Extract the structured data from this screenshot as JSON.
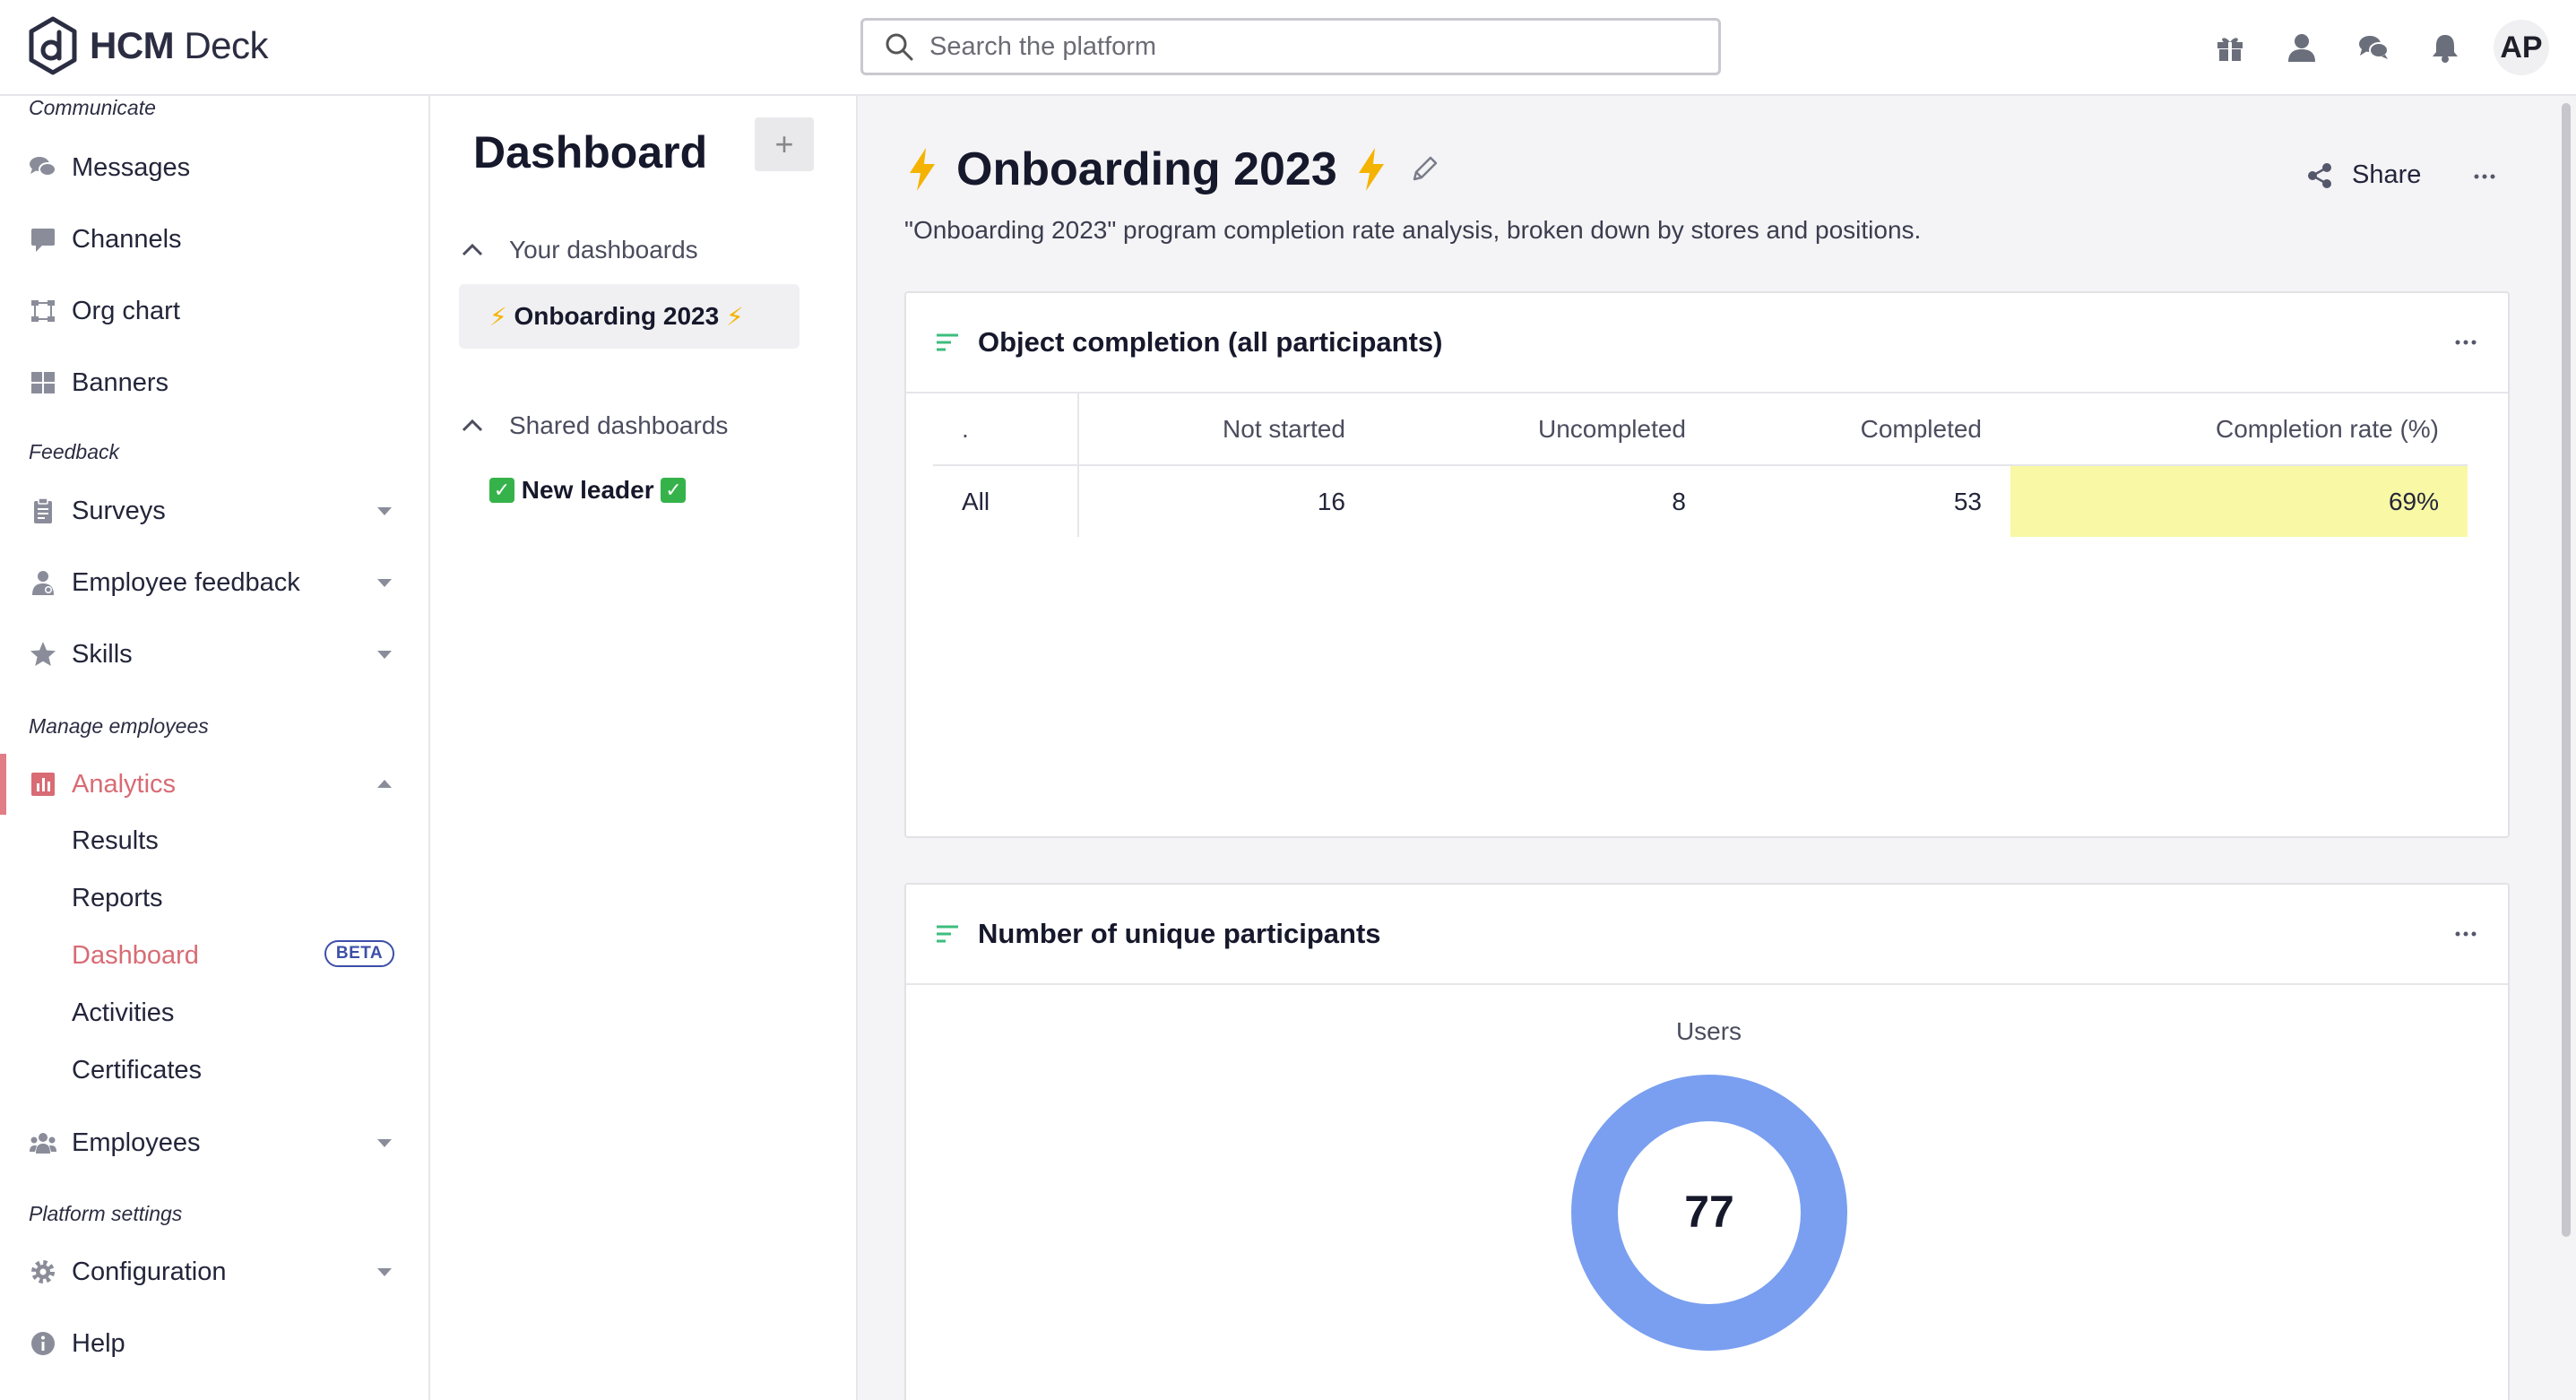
{
  "app": {
    "logo_bold": "HCM",
    "logo_light": "Deck"
  },
  "search": {
    "placeholder": "Search the platform"
  },
  "user": {
    "initials": "AP"
  },
  "top_icons": [
    "gift-icon",
    "person-icon",
    "chat-icon",
    "bell-icon"
  ],
  "sidebar": {
    "sections": {
      "communicate": "Communicate",
      "feedback": "Feedback",
      "manage": "Manage employees",
      "platform": "Platform settings"
    },
    "items": {
      "messages": "Messages",
      "channels": "Channels",
      "org_chart": "Org chart",
      "banners": "Banners",
      "surveys": "Surveys",
      "employee_feedback": "Employee feedback",
      "skills": "Skills",
      "analytics": "Analytics",
      "employees": "Employees",
      "configuration": "Configuration",
      "help": "Help"
    },
    "analytics_sub": {
      "results": "Results",
      "reports": "Reports",
      "dashboard": "Dashboard",
      "dashboard_badge": "BETA",
      "activities": "Activities",
      "certificates": "Certificates"
    },
    "accent_color": "#d86b74"
  },
  "dash_panel": {
    "title": "Dashboard",
    "add_label": "+",
    "your_dashboards": "Your dashboards",
    "shared_dashboards": "Shared dashboards",
    "your_items": [
      "Onboarding 2023"
    ],
    "shared_items": [
      "New leader"
    ]
  },
  "main": {
    "title": "Onboarding 2023",
    "description": "\"Onboarding 2023\" program completion rate analysis, broken down by stores and positions.",
    "share_label": "Share",
    "card1": {
      "title": "Object completion (all participants)",
      "headers": [
        ".",
        "Not started",
        "Uncompleted",
        "Completed",
        "Completion rate (%)"
      ],
      "rows": [
        [
          "All",
          "16",
          "8",
          "53",
          "69%"
        ]
      ],
      "highlight_color": "#f8f8a5"
    },
    "card2": {
      "title": "Number of unique participants",
      "metric_label": "Users",
      "metric_value": "77",
      "ring_color": "#7a9ff0"
    }
  }
}
